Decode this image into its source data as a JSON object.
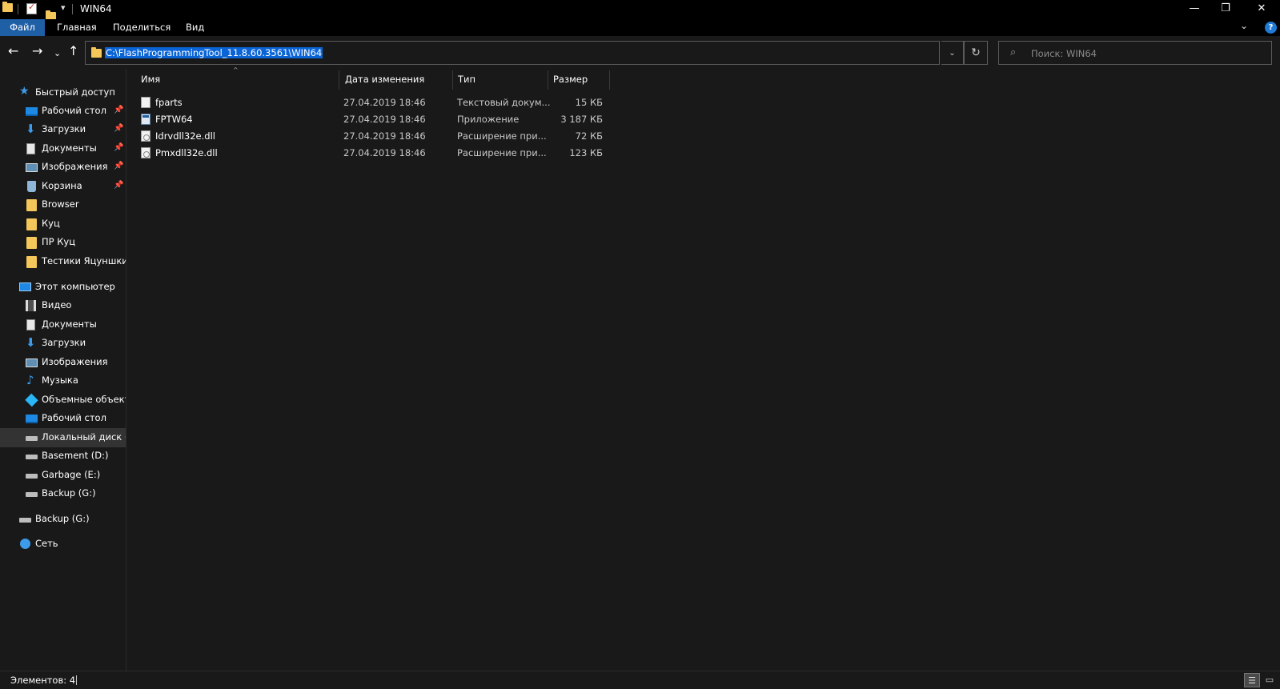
{
  "window": {
    "title": "WIN64",
    "qa_dropdown": "▾",
    "minimize": "—",
    "restore": "❐",
    "close": "✕"
  },
  "ribbon": {
    "tabs": [
      "Файл",
      "Главная",
      "Поделиться",
      "Вид"
    ],
    "expand": "⌄",
    "help": "?"
  },
  "nav": {
    "back": "←",
    "forward": "→",
    "recent": "⌄",
    "up": "↑",
    "address": "C:\\FlashProgrammingTool_11.8.60.3561\\WIN64",
    "address_dropdown": "⌄",
    "refresh": "↻",
    "search_placeholder": "Поиск: WIN64",
    "search_icon": "⌕"
  },
  "sidebar": {
    "quick_access": {
      "label": "Быстрый доступ",
      "icon": "star-icon",
      "items": [
        {
          "label": "Рабочий стол",
          "icon": "desktop-icon",
          "pinned": true
        },
        {
          "label": "Загрузки",
          "icon": "download-icon",
          "pinned": true
        },
        {
          "label": "Документы",
          "icon": "documents-icon",
          "pinned": true
        },
        {
          "label": "Изображения",
          "icon": "pictures-icon",
          "pinned": true
        },
        {
          "label": "Корзина",
          "icon": "recycle-bin-icon",
          "pinned": true
        },
        {
          "label": "Browser",
          "icon": "folder-icon",
          "pinned": false
        },
        {
          "label": "Куц",
          "icon": "folder-icon",
          "pinned": false
        },
        {
          "label": "ПР Куц",
          "icon": "folder-icon",
          "pinned": false
        },
        {
          "label": "Тестики Яцуншки",
          "icon": "folder-icon",
          "pinned": false
        }
      ],
      "pin_glyph": "📌"
    },
    "this_pc": {
      "label": "Этот компьютер",
      "icon": "computer-icon",
      "items": [
        {
          "label": "Видео",
          "icon": "video-icon"
        },
        {
          "label": "Документы",
          "icon": "documents-icon"
        },
        {
          "label": "Загрузки",
          "icon": "download-icon"
        },
        {
          "label": "Изображения",
          "icon": "pictures-icon"
        },
        {
          "label": "Музыка",
          "icon": "music-icon"
        },
        {
          "label": "Объемные объекты",
          "icon": "3d-objects-icon"
        },
        {
          "label": "Рабочий стол",
          "icon": "desktop-icon"
        },
        {
          "label": "Локальный диск (C:)",
          "icon": "drive-c-icon",
          "selected": true
        },
        {
          "label": "Basement (D:)",
          "icon": "drive-icon"
        },
        {
          "label": "Garbage (E:)",
          "icon": "drive-icon"
        },
        {
          "label": "Backup (G:)",
          "icon": "drive-icon"
        }
      ]
    },
    "backup": {
      "label": "Backup (G:)",
      "icon": "drive-icon"
    },
    "network": {
      "label": "Сеть",
      "icon": "network-icon"
    }
  },
  "files": {
    "columns": [
      "Имя",
      "Дата изменения",
      "Тип",
      "Размер"
    ],
    "sort_glyph": "^",
    "rows": [
      {
        "name": "fparts",
        "date": "27.04.2019 18:46",
        "type": "Текстовый докум...",
        "size": "15 КБ",
        "icon": "text-file-icon"
      },
      {
        "name": "FPTW64",
        "date": "27.04.2019 18:46",
        "type": "Приложение",
        "size": "3 187 КБ",
        "icon": "application-icon"
      },
      {
        "name": "Idrvdll32e.dll",
        "date": "27.04.2019 18:46",
        "type": "Расширение при...",
        "size": "72 КБ",
        "icon": "dll-file-icon"
      },
      {
        "name": "Pmxdll32e.dll",
        "date": "27.04.2019 18:46",
        "type": "Расширение при...",
        "size": "123 КБ",
        "icon": "dll-file-icon"
      }
    ]
  },
  "status": {
    "count": "Элементов: 4",
    "view_details": "☰",
    "view_tiles": "▭"
  },
  "colors": {
    "background": "#191919",
    "titlebar": "#000000",
    "accent": "#1f5fa6",
    "selection": "#0a64d6"
  }
}
